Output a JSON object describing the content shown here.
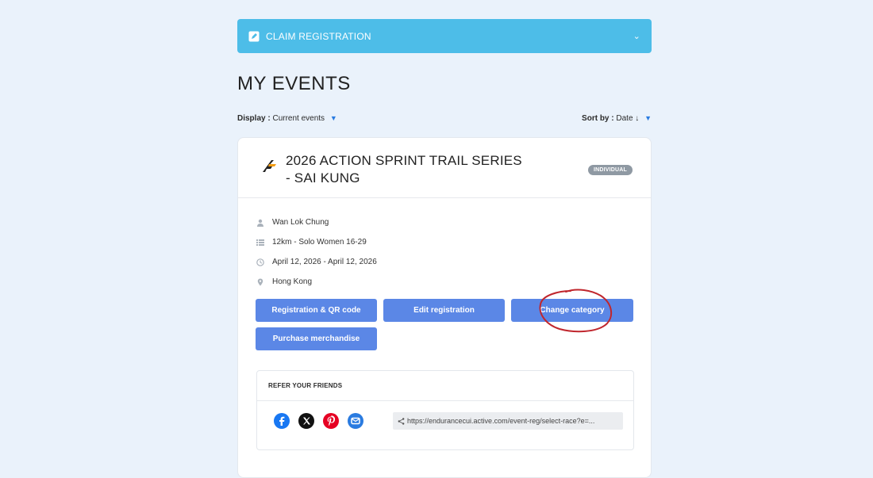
{
  "claim": {
    "label": "CLAIM REGISTRATION",
    "icon": "edit-icon",
    "chevron": "chevron-down-icon"
  },
  "page": {
    "title": "MY EVENTS"
  },
  "filters": {
    "display_label": "Display :",
    "display_value": "Current events",
    "sort_label": "Sort by :",
    "sort_value": "Date ↓"
  },
  "event": {
    "title_line1": "2026 ACTION SPRINT TRAIL SERIES",
    "title_line2": "- SAI KUNG",
    "badge": "INDIVIDUAL",
    "logo": "action-sprint-logo",
    "participant": "Wan Lok Chung",
    "category": "12km - Solo Women 16-29",
    "dates": "April 12, 2026 - April 12, 2026",
    "location": "Hong Kong"
  },
  "buttons": {
    "registration_qr": "Registration & QR code",
    "edit_registration": "Edit registration",
    "change_category": "Change category",
    "purchase_merch": "Purchase merchandise"
  },
  "refer": {
    "heading": "REFER YOUR FRIENDS",
    "share_icons": [
      "facebook-icon",
      "x-icon",
      "pinterest-icon",
      "email-icon"
    ],
    "link": "https://endurancecui.active.com/event-reg/select-race?e=..."
  },
  "colors": {
    "claim_bar": "#4dbde8",
    "button": "#5b87e6",
    "badge": "#8f99a3",
    "background": "#eaf2fb",
    "annotation": "#c0262d"
  }
}
